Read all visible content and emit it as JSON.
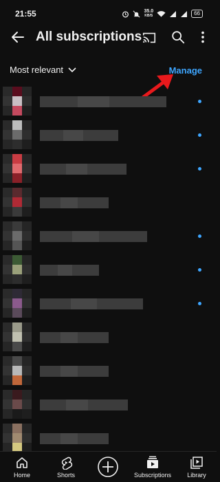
{
  "status_bar": {
    "time": "21:55",
    "net_speed": "35.0",
    "net_unit": "KB/S",
    "battery": "66"
  },
  "header": {
    "title": "All subscriptions",
    "icons": [
      "back-arrow-icon",
      "cast-icon",
      "search-icon",
      "more-vert-icon"
    ]
  },
  "filter": {
    "sort_label": "Most relevant",
    "manage_label": "Manage"
  },
  "colors": {
    "accent": "#3ea6ff",
    "annotation_arrow": "#e8191c",
    "background": "#0f0f0f"
  },
  "channels": [
    {
      "avatar": [
        "#5a0d1e",
        "#c9bfc4",
        "#c44a5f"
      ],
      "new": true
    },
    {
      "avatar": [
        "#bdbdbd",
        "#6b6b6b",
        "#2d2d2d"
      ],
      "new": true
    },
    {
      "avatar": [
        "#c93c43",
        "#e06a6e",
        "#8a2028"
      ],
      "new": true
    },
    {
      "avatar": [
        "#5a2a2e",
        "#b02a35",
        "#3a3a3a"
      ],
      "new": false
    },
    {
      "avatar": [
        "#3a3a3a",
        "#6b6b6b",
        "#555555"
      ],
      "new": true
    },
    {
      "avatar": [
        "#3c5a34",
        "#9aa07a",
        "#2d2d2d"
      ],
      "new": true
    },
    {
      "avatar": [
        "#2e2a35",
        "#8b5a8c",
        "#5a4a5a"
      ],
      "new": true
    },
    {
      "avatar": [
        "#9a9a8a",
        "#c0c0b0",
        "#4a4a4a"
      ],
      "new": false
    },
    {
      "avatar": [
        "#4a4a4a",
        "#b8b8b8",
        "#c0673a"
      ],
      "new": false
    },
    {
      "avatar": [
        "#3a1a1e",
        "#6a4a4a",
        "#1a1a1a"
      ],
      "new": false
    },
    {
      "avatar": [
        "#8a7060",
        "#a08a70",
        "#d4c880"
      ],
      "new": false
    }
  ],
  "bottom_nav": [
    {
      "label": "Home",
      "icon": "home-icon"
    },
    {
      "label": "Shorts",
      "icon": "shorts-icon"
    },
    {
      "label": "",
      "icon": "create-icon"
    },
    {
      "label": "Subscriptions",
      "icon": "subscriptions-icon"
    },
    {
      "label": "Library",
      "icon": "library-icon"
    }
  ]
}
